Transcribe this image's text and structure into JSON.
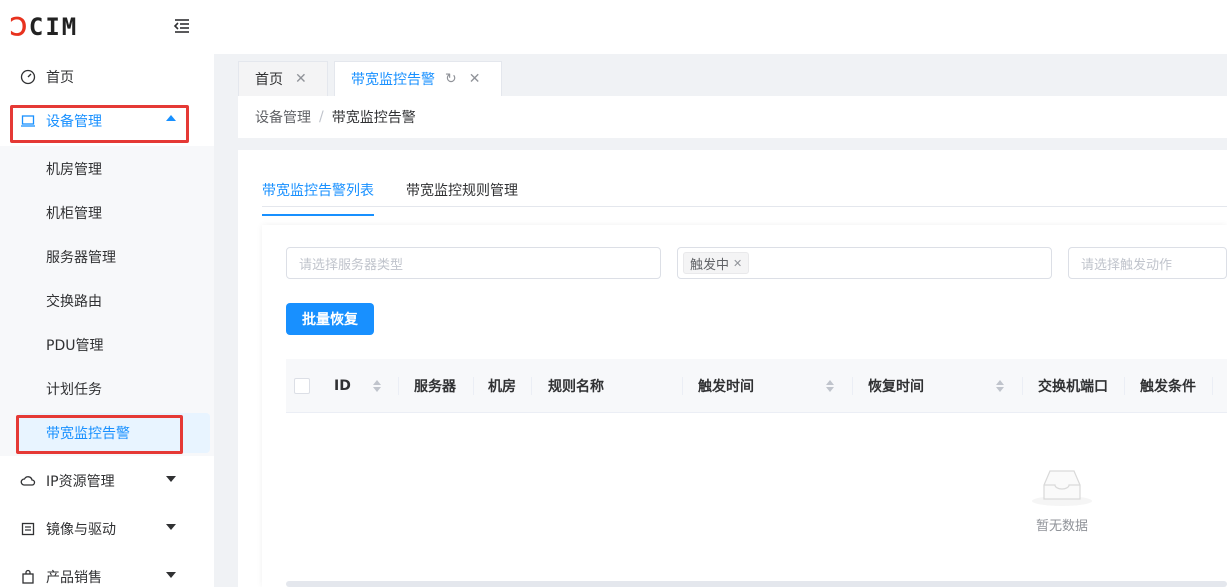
{
  "brand": {
    "logo_text": "CIM",
    "logo_mark": "Ↄ"
  },
  "sidebar": {
    "items": [
      {
        "label": "首页",
        "icon": "dashboard-icon"
      },
      {
        "label": "设备管理",
        "icon": "laptop-icon"
      },
      {
        "label": "IP资源管理",
        "icon": "cloud-icon"
      },
      {
        "label": "镜像与驱动",
        "icon": "image-icon"
      },
      {
        "label": "产品销售",
        "icon": "bag-icon"
      }
    ],
    "submenu": [
      "机房管理",
      "机柜管理",
      "服务器管理",
      "交换路由",
      "PDU管理",
      "计划任务",
      "带宽监控告警"
    ]
  },
  "tabs": [
    {
      "label": "首页"
    },
    {
      "label": "带宽监控告警"
    }
  ],
  "breadcrumb": {
    "parent": "设备管理",
    "separator": "/",
    "current": "带宽监控告警"
  },
  "subtabs": [
    "带宽监控告警列表",
    "带宽监控规则管理"
  ],
  "filters": {
    "server_type_placeholder": "请选择服务器类型",
    "status_tag": "触发中",
    "action_placeholder": "请选择触发动作"
  },
  "buttons": {
    "batch_restore": "批量恢复"
  },
  "table": {
    "headers": [
      "ID",
      "服务器",
      "机房",
      "规则名称",
      "触发时间",
      "恢复时间",
      "交换机端口",
      "触发条件"
    ],
    "empty_text": "暂无数据"
  },
  "colors": {
    "primary": "#1890ff",
    "highlight_box": "#e53935",
    "brand_red": "#e8321e"
  }
}
